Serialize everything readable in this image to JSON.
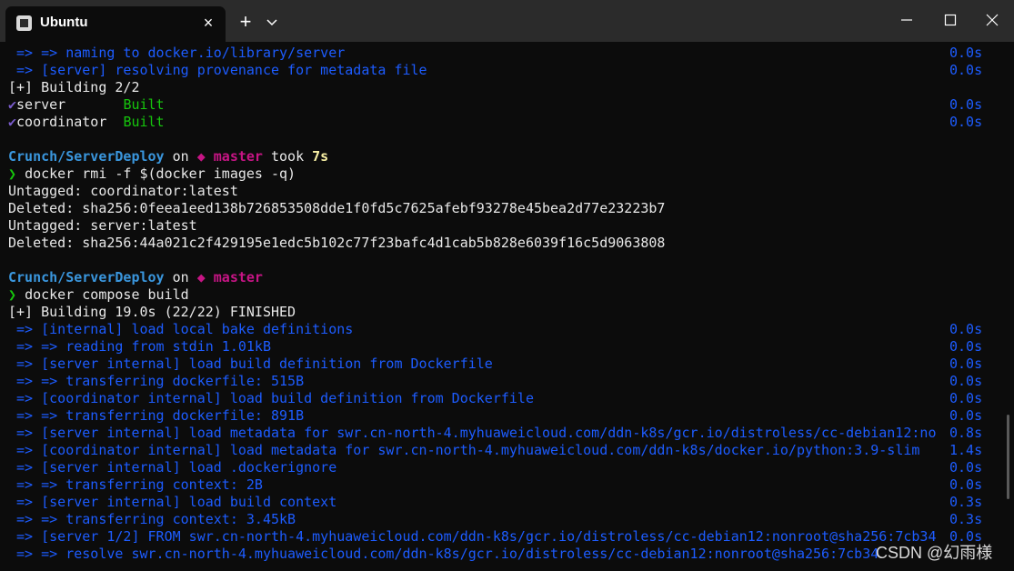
{
  "window": {
    "tab_title": "Ubuntu",
    "tab_close_icon": "close-icon",
    "new_tab_icon": "plus-icon",
    "dropdown_icon": "chevron-down-icon",
    "controls": [
      "minimize-icon",
      "maximize-icon",
      "close-icon"
    ]
  },
  "terminal": {
    "lines": [
      {
        "arrow": " => => ",
        "text": "naming to docker.io/library/server",
        "time": "0.0s"
      },
      {
        "arrow": " => ",
        "text": "[server] resolving provenance for metadata file",
        "time": "0.0s"
      },
      {
        "text": "[+] Building 2/2"
      },
      {
        "mark": "✔",
        "name": "server       ",
        "status": "Built",
        "time": "0.0s"
      },
      {
        "mark": "✔",
        "name": "coordinator  ",
        "status": "Built",
        "time": "0.0s"
      },
      {
        "text": ""
      },
      {
        "path": "Crunch/ServerDeploy",
        "on": " on ",
        "branch_icon": "◆ ",
        "branch": "master",
        "took": " took ",
        "duration": "7s"
      },
      {
        "prompt": "❯ ",
        "text": "docker rmi -f $(docker images -q)"
      },
      {
        "text": "Untagged: coordinator:latest"
      },
      {
        "text": "Deleted: sha256:0feea1eed138b726853508dde1f0fd5c7625afebf93278e45bea2d77e23223b7"
      },
      {
        "text": "Untagged: server:latest"
      },
      {
        "text": "Deleted: sha256:44a021c2f429195e1edc5b102c77f23bafc4d1cab5b828e6039f16c5d9063808"
      },
      {
        "text": ""
      },
      {
        "path": "Crunch/ServerDeploy",
        "on": " on ",
        "branch_icon": "◆ ",
        "branch": "master"
      },
      {
        "prompt": "❯ ",
        "text": "docker compose build"
      },
      {
        "text": "[+] Building 19.0s (22/22) FINISHED"
      },
      {
        "arrow": " => ",
        "text": "[internal] load local bake definitions",
        "time": "0.0s"
      },
      {
        "arrow": " => => ",
        "text": "reading from stdin 1.01kB",
        "time": "0.0s"
      },
      {
        "arrow": " => ",
        "text": "[server internal] load build definition from Dockerfile",
        "time": "0.0s"
      },
      {
        "arrow": " => => ",
        "text": "transferring dockerfile: 515B",
        "time": "0.0s"
      },
      {
        "arrow": " => ",
        "text": "[coordinator internal] load build definition from Dockerfile",
        "time": "0.0s"
      },
      {
        "arrow": " => => ",
        "text": "transferring dockerfile: 891B",
        "time": "0.0s"
      },
      {
        "arrow": " => ",
        "text": "[server internal] load metadata for swr.cn-north-4.myhuaweicloud.com/ddn-k8s/gcr.io/distroless/cc-debian12:no",
        "time": "0.8s"
      },
      {
        "arrow": " => ",
        "text": "[coordinator internal] load metadata for swr.cn-north-4.myhuaweicloud.com/ddn-k8s/docker.io/python:3.9-slim",
        "time": "1.4s"
      },
      {
        "arrow": " => ",
        "text": "[server internal] load .dockerignore",
        "time": "0.0s"
      },
      {
        "arrow": " => => ",
        "text": "transferring context: 2B",
        "time": "0.0s"
      },
      {
        "arrow": " => ",
        "text": "[server internal] load build context",
        "time": "0.3s"
      },
      {
        "arrow": " => => ",
        "text": "transferring context: 3.45kB",
        "time": "0.3s"
      },
      {
        "arrow": " => ",
        "text": "[server 1/2] FROM swr.cn-north-4.myhuaweicloud.com/ddn-k8s/gcr.io/distroless/cc-debian12:nonroot@sha256:7cb34",
        "time": "0.0s"
      },
      {
        "arrow": " => => ",
        "text": "resolve swr.cn-north-4.myhuaweicloud.com/ddn-k8s/gcr.io/distroless/cc-debian12:nonroot@sha256:7cb34"
      }
    ]
  },
  "watermark": "CSDN @幻雨様",
  "colors": {
    "background": "#0c0c0c",
    "titlebar": "#2b2b2b",
    "build_blue": "#1d5cff",
    "path_cyan": "#3a96dd",
    "branch_magenta": "#c71585",
    "built_green": "#16c60c",
    "duration_yellow": "#f9f1a5"
  }
}
